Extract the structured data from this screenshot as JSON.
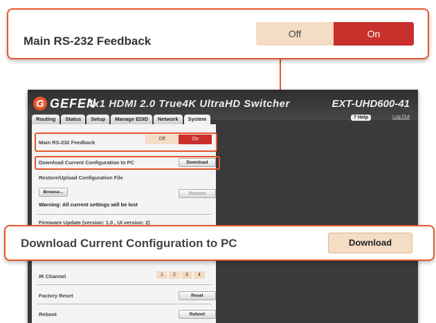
{
  "callout_top": {
    "label": "Main RS-232 Feedback",
    "off": "Off",
    "on": "On"
  },
  "callout_bottom": {
    "label": "Download Current Configuration to PC",
    "button": "Download"
  },
  "app": {
    "logo": "GEFEN",
    "product": "4x1 HDMI 2.0 True4K UltraHD Switcher",
    "model": "EXT-UHD600-41",
    "help": "? Help",
    "logout": "Log Out",
    "tabs": [
      "Routing",
      "Status",
      "Setup",
      "Manage EDID",
      "Network",
      "System"
    ]
  },
  "panel": {
    "rs232_label": "Main RS-232 Feedback",
    "rs232_off": "Off",
    "rs232_on": "On",
    "download_label": "Download Current Configuration to PC",
    "download_btn": "Download",
    "restore_label": "Restore/Upload Configuration File",
    "browse_btn": "Browse...",
    "restore_btn": "Restore",
    "warning": "Warning: All current settings will be lost",
    "firmware_label": "Firmware Update (version: 1.0 , UI version: 2)",
    "ir_label": "IR Channel",
    "ir_channels": [
      "1",
      "2",
      "3",
      "4"
    ],
    "factory_label": "Factory Reset",
    "reset_btn": "Reset",
    "reboot_label": "Reboot",
    "reboot_btn": "Reboot"
  },
  "colors": {
    "accent": "#e8542a",
    "on_red": "#c9302c",
    "off_peach": "#f5dcc5"
  }
}
